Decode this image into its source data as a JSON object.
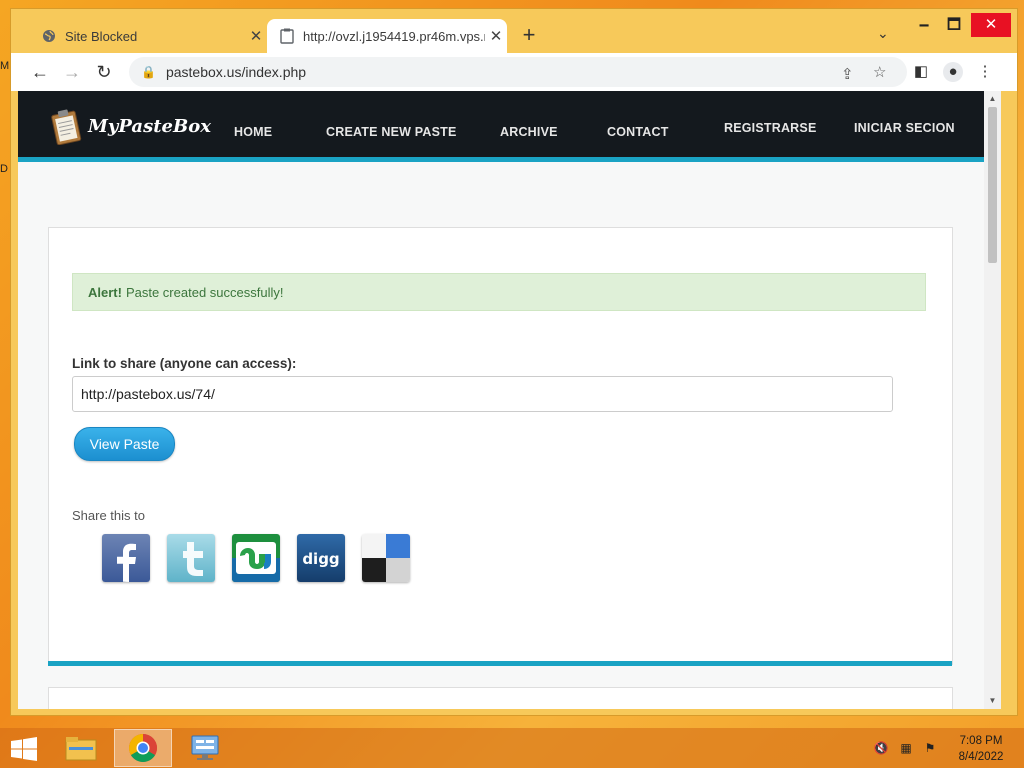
{
  "desktop": {
    "edge_labels": [
      "M",
      "D"
    ]
  },
  "browser": {
    "tabs": [
      {
        "title": "Site Blocked",
        "active": false
      },
      {
        "title": "http://ovzl.j1954419.pr46m.vps.n",
        "active": true
      }
    ],
    "new_tab": "+",
    "window_controls": {
      "minimize": "🗕",
      "maximize": "🗖",
      "close": "✕"
    },
    "url": "pastebox.us/index.php"
  },
  "site": {
    "logo_text": "MyPasteBox",
    "menu": [
      "HOME",
      "CREATE NEW PASTE",
      "ARCHIVE",
      "CONTACT"
    ],
    "menu_right": [
      "REGISTRARSE",
      "INICIAR SECION"
    ],
    "accent_color": "#1aa3c4",
    "nav_bg": "#14191e"
  },
  "content": {
    "alert": {
      "strong": "Alert!",
      "message": "Paste created successfully!"
    },
    "link_label": "Link to share (anyone can access):",
    "link_value": "http://pastebox.us/74/",
    "view_button": "View Paste",
    "share_label": "Share this to",
    "share_services": [
      {
        "name": "facebook",
        "glyph": "f",
        "color": "#3b5998"
      },
      {
        "name": "twitter",
        "glyph": "t",
        "color": "#7fc7dc"
      },
      {
        "name": "stumbleupon",
        "glyph": "su",
        "color": "#1f8f3c"
      },
      {
        "name": "digg",
        "glyph": "digg",
        "color": "#1b4f86"
      },
      {
        "name": "delicious",
        "glyph": "",
        "color": "#3274d1"
      }
    ]
  },
  "taskbar": {
    "time": "7:08 PM",
    "date": "8/4/2022"
  }
}
